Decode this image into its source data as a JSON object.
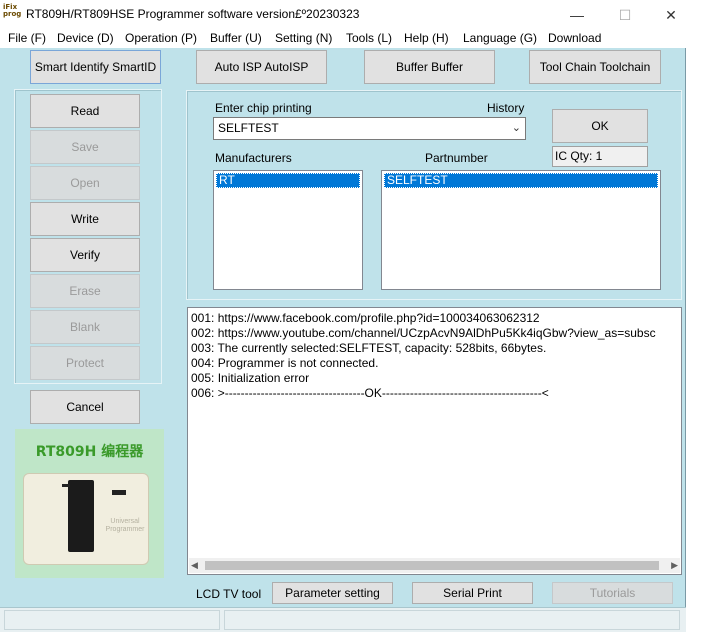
{
  "window": {
    "title": "RT809H/RT809HSE Programmer software version£º20230323",
    "icon_text": "iFix prog",
    "minimize_glyph": "—",
    "maximize_glyph": "☐",
    "close_glyph": "✕"
  },
  "menu": [
    "File (F)",
    "Device (D)",
    "Operation (P)",
    "Buffer (U)",
    "Setting (N)",
    "Tools (L)",
    "Help (H)",
    "Language (G)",
    "Download"
  ],
  "toolbar": {
    "smart_id": "Smart Identify SmartID",
    "auto_isp": "Auto ISP AutoISP",
    "buffer": "Buffer Buffer",
    "toolchain": "Tool Chain Toolchain"
  },
  "actions": {
    "read": "Read",
    "save": "Save",
    "open": "Open",
    "write": "Write",
    "verify": "Verify",
    "erase": "Erase",
    "blank": "Blank",
    "protect": "Protect",
    "cancel": "Cancel"
  },
  "product": {
    "caption": "RT809H 编程器",
    "device_label": "Universal Programmer"
  },
  "chip": {
    "enter_label": "Enter chip printing",
    "history_label": "History",
    "value": "SELFTEST",
    "ok": "OK",
    "ic_qty": "IC Qty: 1",
    "manufacturers_label": "Manufacturers",
    "partnumber_label": "Partnumber",
    "manufacturers": [
      "RT"
    ],
    "partnumbers": [
      "SELFTEST"
    ]
  },
  "log": [
    "001:  https://www.facebook.com/profile.php?id=100034063062312",
    "002:  https://www.youtube.com/channel/UCzpAcvN9AlDhPu5Kk4iqGbw?view_as=subsc",
    "003:  The currently selected:SELFTEST, capacity: 528bits, 66bytes.",
    "004:  Programmer is not connected.",
    "005:  Initialization error",
    "006:  >-----------------------------------OK----------------------------------------<"
  ],
  "bottom": {
    "lcd_label": "LCD TV tool",
    "parameter": "Parameter setting",
    "serial": "Serial Print",
    "tutorials": "Tutorials"
  },
  "colors": {
    "background": "#bfe2ea",
    "selection": "#0078d7"
  }
}
